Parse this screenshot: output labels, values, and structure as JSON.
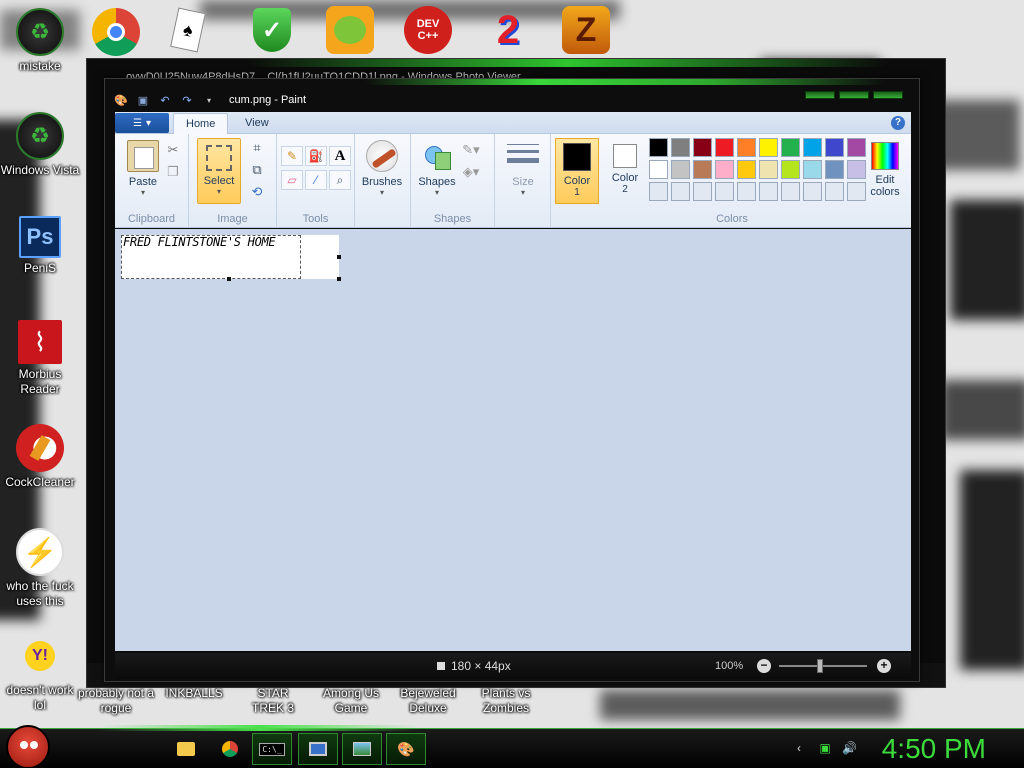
{
  "desktop": {
    "top_icons": [
      {
        "name": "chrome",
        "icon": "chrome-icon"
      },
      {
        "name": "solitaire",
        "icon": "cards-icon"
      },
      {
        "name": "security",
        "icon": "shield-check-icon"
      },
      {
        "name": "bad-piggies",
        "icon": "pig-icon"
      },
      {
        "name": "devcpp",
        "icon": "devcpp-icon",
        "text": "DEV C++"
      },
      {
        "name": "game-2",
        "icon": "number-2-icon"
      },
      {
        "name": "game-z",
        "icon": "z-icon"
      }
    ],
    "left_icons": [
      {
        "label": "mistake",
        "icon": "recycle-icon"
      },
      {
        "label": "Windows Vista",
        "icon": "recycle-icon"
      },
      {
        "label": "PeniS",
        "icon": "photoshop-icon",
        "text": "Ps"
      },
      {
        "label": "Morbius Reader",
        "icon": "pdf-icon"
      },
      {
        "label": "CockCleaner",
        "icon": "ccleaner-icon"
      },
      {
        "label": "who the fuck uses this",
        "icon": "lightning-icon"
      },
      {
        "label": "doesn't work lol",
        "icon": "yahoo-icon",
        "text": "Y!"
      }
    ],
    "bottom_labels": [
      "probably not a rogue",
      "INKBALLS",
      "STAR TREK 3",
      "Among Us Game",
      "Bejeweled Deluxe",
      "Plants vs Zombies"
    ]
  },
  "bg_window": {
    "title": "...ovwD0U25Nuw4P8dHsD7... Cl(b1fU2uuTO1CDD1l.png - Windows Photo Viewer"
  },
  "paint": {
    "title": "cum.png - Paint",
    "tabs": {
      "home": "Home",
      "view": "View"
    },
    "help": "?",
    "groups": {
      "clipboard": {
        "label": "Clipboard",
        "paste": "Paste"
      },
      "image": {
        "label": "Image",
        "select": "Select"
      },
      "tools": {
        "label": "Tools"
      },
      "brushes": {
        "label": "Brushes"
      },
      "shapes": {
        "label": "Shapes",
        "shapes": "Shapes"
      },
      "size": {
        "label": "Size"
      },
      "color1": {
        "label": "Color",
        "num": "1"
      },
      "color2": {
        "label": "Color",
        "num": "2"
      },
      "colors": {
        "label": "Colors"
      },
      "edit_colors": {
        "line1": "Edit",
        "line2": "colors"
      }
    },
    "palette": [
      [
        "#000000",
        "#7f7f7f",
        "#880015",
        "#ed1c24",
        "#ff7f27",
        "#fff200",
        "#22b14c",
        "#00a2e8",
        "#3f48cc",
        "#a349a4"
      ],
      [
        "#ffffff",
        "#c3c3c3",
        "#b97a57",
        "#ffaec9",
        "#ffc90e",
        "#efe4b0",
        "#b5e61d",
        "#99d9ea",
        "#7092be",
        "#c8bfe7"
      ],
      [
        "#e1e8f2",
        "#e1e8f2",
        "#e1e8f2",
        "#e1e8f2",
        "#e1e8f2",
        "#e1e8f2",
        "#e1e8f2",
        "#e1e8f2",
        "#e1e8f2",
        "#e1e8f2"
      ]
    ],
    "color1_value": "#000000",
    "color2_value": "#ffffff",
    "canvas_text": "FRED FLINTSTONE'S HOME",
    "status": {
      "dimensions": "180 × 44px",
      "zoom": "100%"
    }
  },
  "taskbar": {
    "clock": "4:50 PM",
    "items": [
      {
        "icon": "folder-icon"
      },
      {
        "icon": "chrome-icon"
      },
      {
        "icon": "cmd-icon",
        "text": "C:\\_"
      },
      {
        "icon": "monitor-icon"
      },
      {
        "icon": "photo-viewer-icon"
      },
      {
        "icon": "paint-icon"
      }
    ]
  }
}
